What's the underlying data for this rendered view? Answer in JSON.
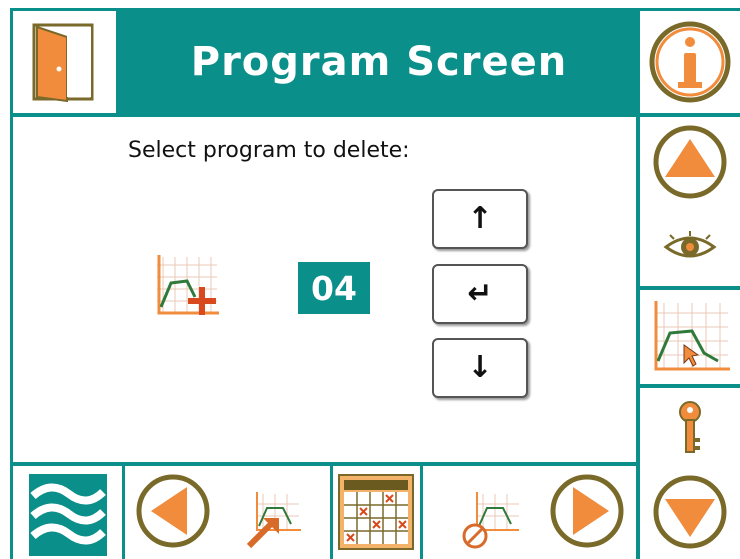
{
  "header": {
    "title": "Program Screen"
  },
  "main": {
    "prompt": "Select program to delete:",
    "program_number": "04"
  },
  "selector": {
    "up_glyph": "↑",
    "enter_glyph": "↵",
    "down_glyph": "↓"
  },
  "colors": {
    "teal": "#0a8f8a",
    "orange": "#f08c3c",
    "olive": "#7a6a2a"
  },
  "icons": {
    "exit": "door-exit-icon",
    "info": "info-icon",
    "nav_up": "arrow-up-circle-icon",
    "view": "eye-icon",
    "graph": "program-graph-icon",
    "lock": "key-icon",
    "nav_down": "arrow-down-circle-icon",
    "logo": "waves-logo-icon",
    "prev": "arrow-left-circle-icon",
    "load": "program-load-icon",
    "calendar": "calendar-grid-icon",
    "remove": "program-delete-icon",
    "next": "arrow-right-circle-icon",
    "add": "program-add-icon"
  }
}
